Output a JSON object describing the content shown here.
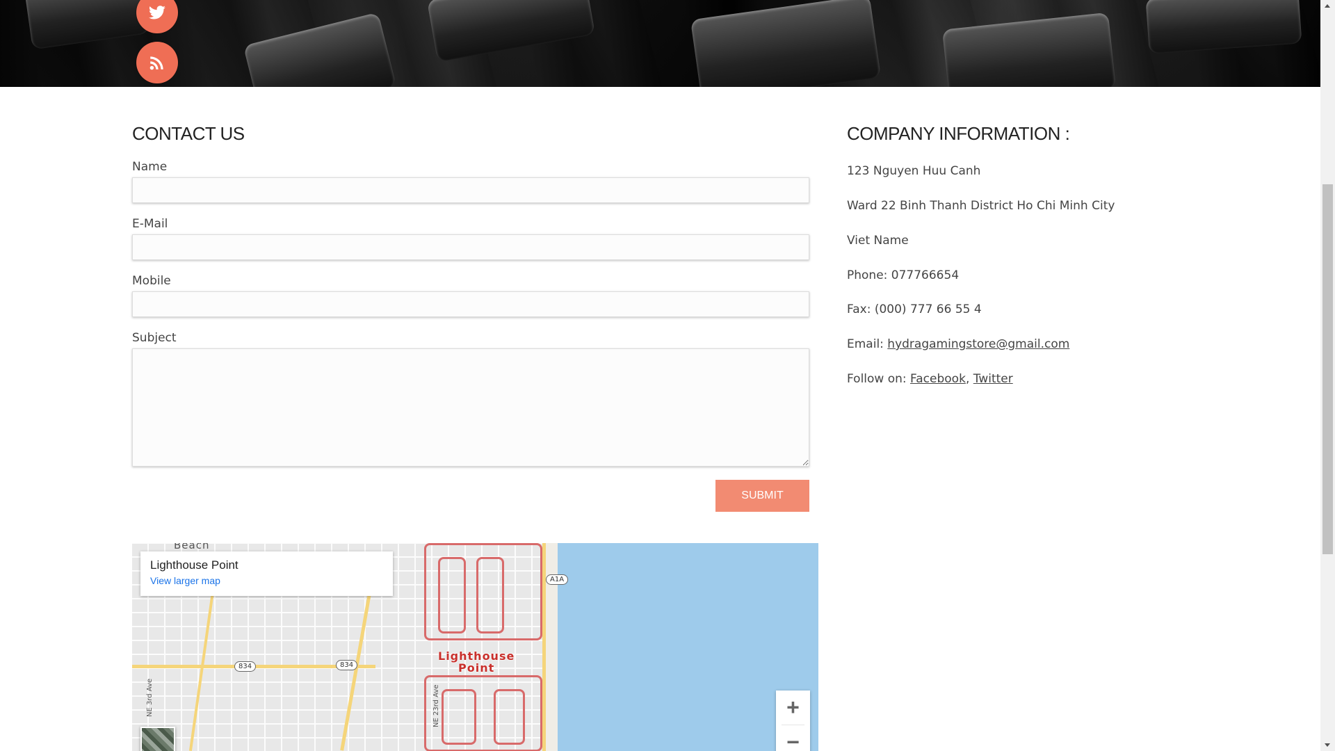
{
  "social": {
    "twitter_icon": "twitter-icon",
    "rss_icon": "rss-icon"
  },
  "contact": {
    "title": "CONTACT US",
    "name_label": "Name",
    "email_label": "E-Mail",
    "mobile_label": "Mobile",
    "subject_label": "Subject",
    "submit_label": "SUBMIT"
  },
  "company": {
    "title": "COMPANY INFORMATION :",
    "address1": "123 Nguyen Huu Canh",
    "address2": "Ward 22 Binh Thanh District Ho Chi Minh City",
    "country": "Viet Name",
    "phone": "Phone: 077766654",
    "fax": "Fax: (000) 777 66 55 4",
    "email_prefix": "Email: ",
    "email": "hydragamingstore@gmail.com",
    "follow_prefix": "Follow on: ",
    "facebook": "Facebook",
    "sep": ", ",
    "twitter": "Twitter"
  },
  "map": {
    "card_title": "Lighthouse Point",
    "card_link": "View larger map",
    "place_line1": "Lighthouse",
    "place_line2": "Point",
    "shield_a1a": "A1A",
    "shield_834a": "834",
    "shield_834b": "834",
    "street1": "NE 3rd Ave",
    "street2": "NE 23rd Ave",
    "beach_label": "Beach",
    "zoom_in": "+",
    "zoom_out": "−"
  },
  "colors": {
    "accent": "#ef6e55",
    "submit": "#f28b72",
    "water": "#9ecbeb"
  }
}
